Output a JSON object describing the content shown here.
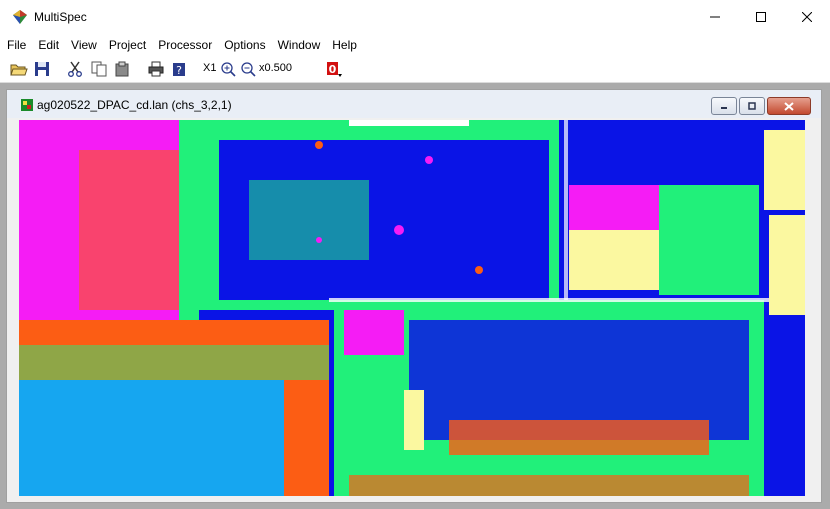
{
  "window": {
    "title": "MultiSpec",
    "icon": "multispec-icon",
    "controls": {
      "minimize": "minimize-icon",
      "maximize": "maximize-icon",
      "close": "close-icon"
    }
  },
  "menubar": {
    "items": [
      {
        "label": "File"
      },
      {
        "label": "Edit"
      },
      {
        "label": "View"
      },
      {
        "label": "Project"
      },
      {
        "label": "Processor"
      },
      {
        "label": "Options"
      },
      {
        "label": "Window"
      },
      {
        "label": "Help"
      }
    ]
  },
  "toolbar": {
    "buttons": [
      "open-icon",
      "save-icon",
      "cut-icon",
      "copy-icon",
      "paste-icon",
      "print-icon",
      "help-icon",
      "zoom-x1-icon",
      "zoom-in-icon",
      "zoom-out-icon"
    ],
    "zoom_x1_label": "X1",
    "zoom_level": "x0.500",
    "overlay_indicator": "0"
  },
  "image_window": {
    "title": "ag020522_DPAC_cd.lan (chs_3,2,1)",
    "colors": {
      "blue": "#0a14e6",
      "green": "#21f07a",
      "orange": "#fc5d14",
      "magenta": "#f51cf5",
      "yellow": "#fbf8a0",
      "cyan": "#16a6f0",
      "white": "#ffffff"
    }
  }
}
